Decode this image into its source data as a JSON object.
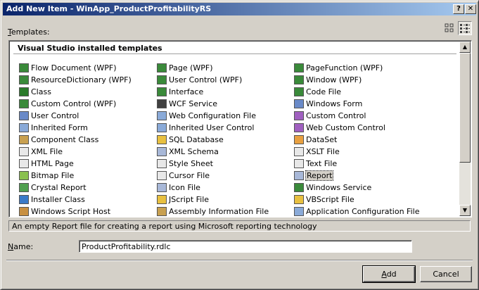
{
  "window": {
    "title": "Add New Item - WinApp_ProductProfitabilityRS",
    "help_label": "?",
    "close_label": "✕"
  },
  "templates_label": "Templates:",
  "view_buttons": {
    "large_icons": "large-icons-view-icon",
    "small_icons": "small-icons-view-icon"
  },
  "section_title": "Visual Studio installed templates",
  "columns": [
    [
      {
        "label": "Flow Document (WPF)",
        "icon": "flow-document-icon",
        "color": "#3a8a3a"
      },
      {
        "label": "ResourceDictionary (WPF)",
        "icon": "resource-dictionary-icon",
        "color": "#3a8a3a"
      },
      {
        "label": "Class",
        "icon": "class-icon",
        "color": "#2a7a2a"
      },
      {
        "label": "Custom Control (WPF)",
        "icon": "custom-control-wpf-icon",
        "color": "#3a8a3a"
      },
      {
        "label": "User Control",
        "icon": "user-control-icon",
        "color": "#6a8ac8"
      },
      {
        "label": "Inherited Form",
        "icon": "inherited-form-icon",
        "color": "#8aaad8"
      },
      {
        "label": "Component Class",
        "icon": "component-class-icon",
        "color": "#c8a050"
      },
      {
        "label": "XML File",
        "icon": "xml-file-icon",
        "color": "#e8e8e8"
      },
      {
        "label": "HTML Page",
        "icon": "html-page-icon",
        "color": "#e8e8e8"
      },
      {
        "label": "Bitmap File",
        "icon": "bitmap-file-icon",
        "color": "#8ac050"
      },
      {
        "label": "Crystal Report",
        "icon": "crystal-report-icon",
        "color": "#50a050"
      },
      {
        "label": "Installer Class",
        "icon": "installer-class-icon",
        "color": "#3a7ac8"
      },
      {
        "label": "Windows Script Host",
        "icon": "windows-script-host-icon",
        "color": "#c89040"
      }
    ],
    [
      {
        "label": "Page (WPF)",
        "icon": "page-wpf-icon",
        "color": "#3a8a3a"
      },
      {
        "label": "User Control (WPF)",
        "icon": "user-control-wpf-icon",
        "color": "#3a8a3a"
      },
      {
        "label": "Interface",
        "icon": "interface-icon",
        "color": "#3a8a3a"
      },
      {
        "label": "WCF Service",
        "icon": "wcf-service-icon",
        "color": "#404040"
      },
      {
        "label": "Web Configuration File",
        "icon": "web-config-icon",
        "color": "#8aaad8"
      },
      {
        "label": "Inherited User Control",
        "icon": "inherited-user-control-icon",
        "color": "#8aaad8"
      },
      {
        "label": "SQL Database",
        "icon": "sql-database-icon",
        "color": "#e8c040"
      },
      {
        "label": "XML Schema",
        "icon": "xml-schema-icon",
        "color": "#a8b8d8"
      },
      {
        "label": "Style Sheet",
        "icon": "style-sheet-icon",
        "color": "#e8e8e8"
      },
      {
        "label": "Cursor File",
        "icon": "cursor-file-icon",
        "color": "#e8e8e8"
      },
      {
        "label": "Icon File",
        "icon": "icon-file-icon",
        "color": "#a8b8d8"
      },
      {
        "label": "JScript File",
        "icon": "jscript-file-icon",
        "color": "#e8c040"
      },
      {
        "label": "Assembly Information File",
        "icon": "assembly-info-icon",
        "color": "#c8a050"
      }
    ],
    [
      {
        "label": "PageFunction (WPF)",
        "icon": "page-function-icon",
        "color": "#3a8a3a"
      },
      {
        "label": "Window (WPF)",
        "icon": "window-wpf-icon",
        "color": "#3a8a3a"
      },
      {
        "label": "Code File",
        "icon": "code-file-icon",
        "color": "#3a8a3a"
      },
      {
        "label": "Windows Form",
        "icon": "windows-form-icon",
        "color": "#6a8ac8"
      },
      {
        "label": "Custom Control",
        "icon": "custom-control-icon",
        "color": "#a060c0"
      },
      {
        "label": "Web Custom Control",
        "icon": "web-custom-control-icon",
        "color": "#a060c0"
      },
      {
        "label": "DataSet",
        "icon": "dataset-icon",
        "color": "#e8a040"
      },
      {
        "label": "XSLT File",
        "icon": "xslt-file-icon",
        "color": "#e8e8e8"
      },
      {
        "label": "Text File",
        "icon": "text-file-icon",
        "color": "#e8e8e8"
      },
      {
        "label": "Report",
        "icon": "report-icon",
        "color": "#a8b8d8",
        "selected": true
      },
      {
        "label": "Windows Service",
        "icon": "windows-service-icon",
        "color": "#3a8a3a"
      },
      {
        "label": "VBScript File",
        "icon": "vbscript-file-icon",
        "color": "#e8c040"
      },
      {
        "label": "Application Configuration File",
        "icon": "app-config-icon",
        "color": "#8aaad8"
      }
    ]
  ],
  "description": "An empty Report file for creating a report using Microsoft reporting technology",
  "name_label": "Name:",
  "name_value": "ProductProfitability.rdlc",
  "buttons": {
    "add": "Add",
    "cancel": "Cancel"
  }
}
